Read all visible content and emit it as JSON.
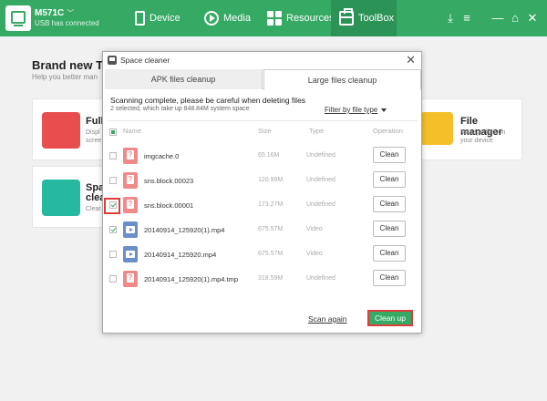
{
  "topbar": {
    "device_name": "M571C",
    "device_status": "USB has connected",
    "tabs": [
      {
        "label": "Device",
        "icon": "phone-icon"
      },
      {
        "label": "Media",
        "icon": "play-icon"
      },
      {
        "label": "Resources",
        "icon": "grid-icon"
      },
      {
        "label": "ToolBox",
        "icon": "toolbox-icon",
        "active": true
      }
    ],
    "colors": {
      "bar": "#36a964",
      "active_tab": "#2c9356"
    }
  },
  "background": {
    "title": "Brand new To",
    "subtitle": "Help you better man",
    "cards": [
      {
        "title": "Full",
        "desc": "Displ\nscree",
        "icon_color": "#e94e4e"
      },
      {
        "title": "Spa\nclea",
        "desc": "Clear",
        "icon_color": "#27b8a0"
      },
      {
        "title": "File manager",
        "desc": "Manage files on\nyour device",
        "icon_color": "#f5bf2a"
      }
    ]
  },
  "dialog": {
    "title": "Space cleaner",
    "tabs": [
      {
        "label": "APK files cleanup",
        "active": false
      },
      {
        "label": "Large files cleanup",
        "active": true
      }
    ],
    "scan_message": "Scanning complete, please be careful when deleting files",
    "scan_summary": "2 selected, which take up 848.84M system space",
    "filter_label": "Filter by file type",
    "columns": {
      "name": "Name",
      "size": "Size",
      "type": "Type",
      "operation": "Operation"
    },
    "rows": [
      {
        "name": "imgcache.0",
        "size": "65.16M",
        "type": "Undefined",
        "kind": "doc",
        "checked": false,
        "action": "Clean"
      },
      {
        "name": "sns.block.00023",
        "size": "120.99M",
        "type": "Undefined",
        "kind": "doc",
        "checked": false,
        "action": "Clean"
      },
      {
        "name": "sns.block.00001",
        "size": "173.27M",
        "type": "Undefined",
        "kind": "doc",
        "checked": true,
        "action": "Clean"
      },
      {
        "name": "20140914_125920(1).mp4",
        "size": "675.57M",
        "type": "Video",
        "kind": "video",
        "checked": true,
        "action": "Clean"
      },
      {
        "name": "20140914_125920.mp4",
        "size": "675.57M",
        "type": "Video",
        "kind": "video",
        "checked": false,
        "action": "Clean"
      },
      {
        "name": "20140914_125920(1).mp4.tmp",
        "size": "318.59M",
        "type": "Undefined",
        "kind": "doc",
        "checked": false,
        "action": "Clean"
      }
    ],
    "scan_again": "Scan again",
    "cleanup_button": "Clean up",
    "highlight_color": "#e03c3c"
  }
}
